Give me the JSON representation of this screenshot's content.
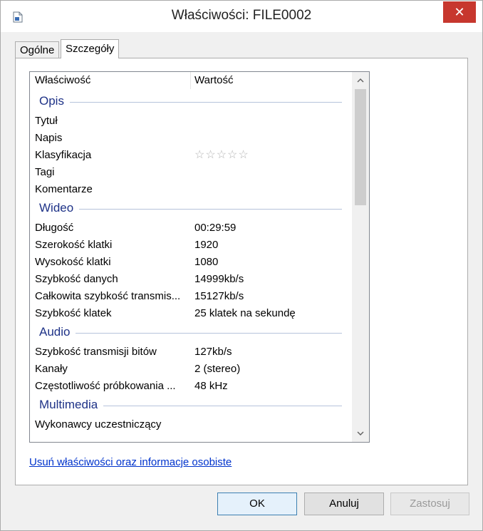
{
  "window": {
    "title": "Właściwości: FILE0002",
    "close_glyph": "✕"
  },
  "tabs": [
    {
      "label": "Ogólne",
      "active": false
    },
    {
      "label": "Szczegóły",
      "active": true
    }
  ],
  "list": {
    "headers": {
      "property": "Właściwość",
      "value": "Wartość"
    },
    "groups": {
      "opis": {
        "title": "Opis",
        "rows": [
          {
            "prop": "Tytuł",
            "val": ""
          },
          {
            "prop": "Napis",
            "val": ""
          },
          {
            "prop": "Klasyfikacja",
            "rating_stars": 0,
            "rating_max": 5
          },
          {
            "prop": "Tagi",
            "val": ""
          },
          {
            "prop": "Komentarze",
            "val": ""
          }
        ]
      },
      "wideo": {
        "title": "Wideo",
        "rows": [
          {
            "prop": "Długość",
            "val": "00:29:59"
          },
          {
            "prop": "Szerokość klatki",
            "val": "1920"
          },
          {
            "prop": "Wysokość klatki",
            "val": "1080"
          },
          {
            "prop": "Szybkość danych",
            "val": "14999kb/s"
          },
          {
            "prop": "Całkowita szybkość transmis...",
            "val": "15127kb/s"
          },
          {
            "prop": "Szybkość klatek",
            "val": "25 klatek na sekundę"
          }
        ]
      },
      "audio": {
        "title": "Audio",
        "rows": [
          {
            "prop": "Szybkość transmisji bitów",
            "val": "127kb/s"
          },
          {
            "prop": "Kanały",
            "val": "2 (stereo)"
          },
          {
            "prop": "Częstotliwość próbkowania ...",
            "val": "48 kHz"
          }
        ]
      },
      "multimedia": {
        "title": "Multimedia",
        "rows": [
          {
            "prop": "Wykonawcy uczestniczący",
            "val": ""
          }
        ]
      }
    }
  },
  "link": {
    "label": "Usuń właściwości oraz informacje osobiste"
  },
  "buttons": {
    "ok": "OK",
    "cancel": "Anuluj",
    "apply": "Zastosuj"
  },
  "icons": {
    "app": "document-icon",
    "close": "close-icon",
    "scroll_up": "chevron-up-icon",
    "scroll_down": "chevron-down-icon",
    "star": "star-outline-icon"
  },
  "colors": {
    "close_bg": "#c7372e",
    "group_title": "#1e3287",
    "link": "#0033cc"
  }
}
